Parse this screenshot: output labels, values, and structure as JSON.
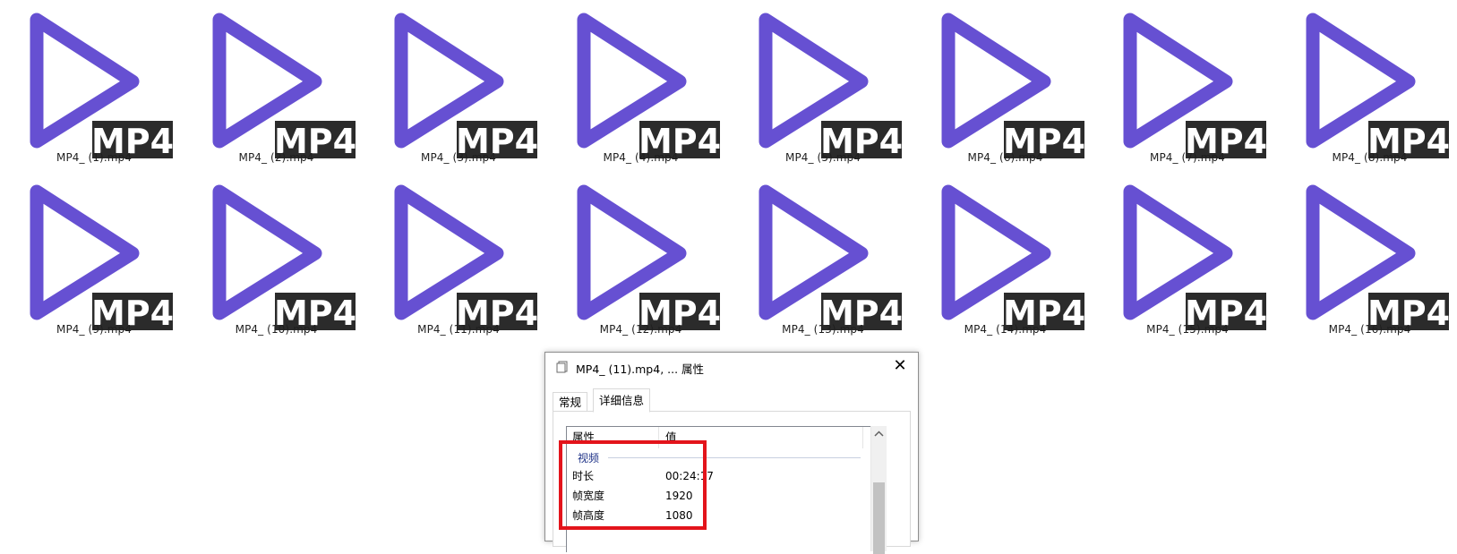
{
  "desktop": {
    "files": [
      {
        "name": "MP4_ (1).mp4",
        "badge": "MP4"
      },
      {
        "name": "MP4_ (2).mp4",
        "badge": "MP4"
      },
      {
        "name": "MP4_ (3).mp4",
        "badge": "MP4"
      },
      {
        "name": "MP4_ (4).mp4",
        "badge": "MP4"
      },
      {
        "name": "MP4_ (5).mp4",
        "badge": "MP4"
      },
      {
        "name": "MP4_ (6).mp4",
        "badge": "MP4"
      },
      {
        "name": "MP4_ (7).mp4",
        "badge": "MP4"
      },
      {
        "name": "MP4_ (8).mp4",
        "badge": "MP4"
      },
      {
        "name": "MP4_ (9).mp4",
        "badge": "MP4"
      },
      {
        "name": "MP4_ (10).mp4",
        "badge": "MP4"
      },
      {
        "name": "MP4_ (11).mp4",
        "badge": "MP4"
      },
      {
        "name": "MP4_ (12).mp4",
        "badge": "MP4"
      },
      {
        "name": "MP4_ (13).mp4",
        "badge": "MP4"
      },
      {
        "name": "MP4_ (14).mp4",
        "badge": "MP4"
      },
      {
        "name": "MP4_ (15).mp4",
        "badge": "MP4"
      },
      {
        "name": "MP4_ (16).mp4",
        "badge": "MP4"
      }
    ],
    "icon": "play-triangle-icon",
    "icon_color": "#6650d2",
    "badge_color": "#2b2b2b"
  },
  "dialog": {
    "title": "MP4_ (11).mp4, ... 属性",
    "title_icon": "file-properties-icon",
    "close_label": "✕",
    "tabs": [
      {
        "label": "常规"
      },
      {
        "label": "详细信息"
      }
    ],
    "columns": {
      "property": "属性",
      "value": "值"
    },
    "group": "视频",
    "rows": [
      {
        "key": "时长",
        "value": "00:24:17"
      },
      {
        "key": "帧宽度",
        "value": "1920"
      },
      {
        "key": "帧高度",
        "value": "1080"
      }
    ],
    "highlight_color": "#e3141b"
  }
}
